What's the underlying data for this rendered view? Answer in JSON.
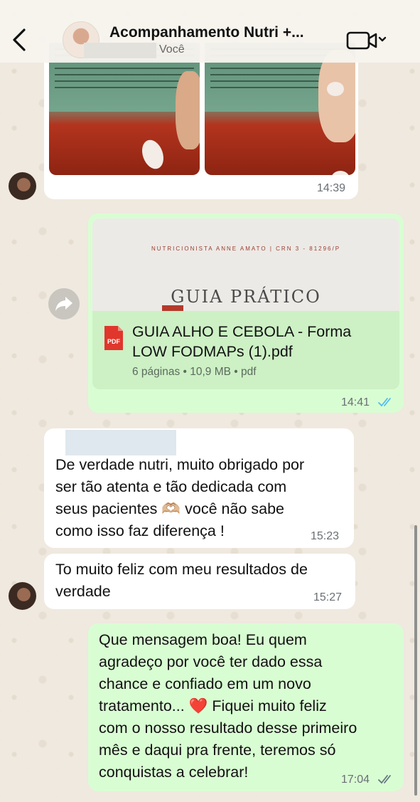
{
  "header": {
    "back_icon": "chevron-left-icon",
    "title": "Acompanhamento Nutri +...",
    "subtitle": "Você",
    "video_icon": "video-call-icon"
  },
  "messages": [
    {
      "type": "image-pair",
      "direction": "incoming",
      "time": "14:39"
    },
    {
      "type": "document",
      "direction": "outgoing",
      "preview_header": "NUTRICIONISTA ANNE AMATO | CRN 3 - 81296/P",
      "preview_title": "GUIA PRÁTICO",
      "file_name": "GUIA ALHO E CEBOLA - Forma LOW FODMAPs (1).pdf",
      "file_meta": "6 páginas • 10,9 MB • pdf",
      "time": "14:41",
      "status": "read"
    },
    {
      "type": "text",
      "direction": "incoming",
      "lines": [
        "De verdade nutri, muito obrigado por",
        "ser tão atenta e tão dedicada com",
        "seus pacientes 🫶🏼 você não sabe",
        "como isso faz diferença !"
      ],
      "time": "15:23"
    },
    {
      "type": "text",
      "direction": "incoming",
      "lines": [
        "To muito feliz com meu resultados de",
        "verdade"
      ],
      "time": "15:27"
    },
    {
      "type": "text",
      "direction": "outgoing",
      "lines": [
        "Que mensagem boa! Eu quem",
        "agradeço por você ter dado essa",
        "chance e confiado em um novo",
        "tratamento... ❤️ Fiquei muito feliz",
        "com o nosso resultado desse primeiro",
        "mês e daqui pra frente, teremos só",
        "conquistas a celebrar!"
      ],
      "time": "17:04",
      "status": "delivered"
    }
  ],
  "colors": {
    "incoming": "#ffffff",
    "outgoing": "#d9fdd3",
    "read_ticks": "#53bdeb",
    "pdf_red": "#e0362c"
  }
}
